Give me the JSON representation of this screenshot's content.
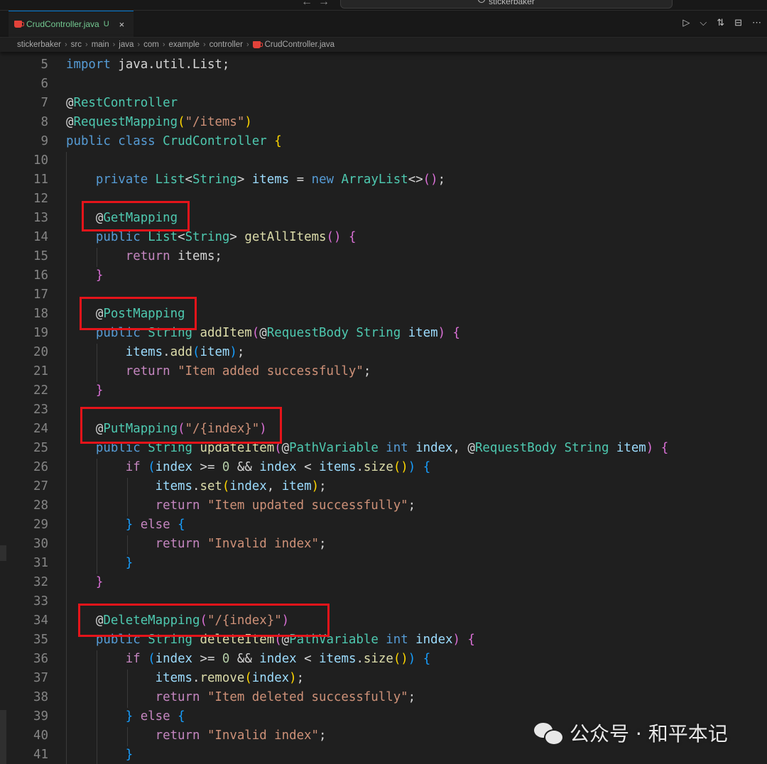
{
  "window": {
    "search_text": "stickerbaker"
  },
  "tab": {
    "file_name": "CrudController.java",
    "status": "U",
    "close_glyph": "×"
  },
  "tab_actions": {
    "run_glyph": "▷",
    "chevron_glyph": "⌵",
    "compare_glyph": "⇅",
    "split_glyph": "⊟",
    "more_glyph": "⋯"
  },
  "breadcrumb": [
    "stickerbaker",
    "src",
    "main",
    "java",
    "com",
    "example",
    "controller",
    "CrudController.java"
  ],
  "code_lines": [
    {
      "n": "5",
      "tokens": [
        [
          "kw",
          "import"
        ],
        [
          "pl",
          " java.util.List;"
        ]
      ]
    },
    {
      "n": "6",
      "tokens": []
    },
    {
      "n": "7",
      "tokens": [
        [
          "pl",
          "@"
        ],
        [
          "ty",
          "RestController"
        ]
      ]
    },
    {
      "n": "8",
      "tokens": [
        [
          "pl",
          "@"
        ],
        [
          "ty",
          "RequestMapping"
        ],
        [
          "br1",
          "("
        ],
        [
          "str",
          "\"/items\""
        ],
        [
          "br1",
          ")"
        ]
      ]
    },
    {
      "n": "9",
      "tokens": [
        [
          "kw",
          "public class "
        ],
        [
          "ty",
          "CrudController "
        ],
        [
          "br1",
          "{"
        ]
      ]
    },
    {
      "n": "10",
      "tokens": []
    },
    {
      "n": "11",
      "tokens": [
        [
          "pl",
          "    "
        ],
        [
          "kw",
          "private "
        ],
        [
          "ty",
          "List"
        ],
        [
          "pl",
          "<"
        ],
        [
          "ty",
          "String"
        ],
        [
          "pl",
          "> "
        ],
        [
          "var",
          "items"
        ],
        [
          "pl",
          " = "
        ],
        [
          "kw",
          "new "
        ],
        [
          "ty",
          "ArrayList"
        ],
        [
          "pl",
          "<>"
        ],
        [
          "br2",
          "()"
        ],
        [
          "pl",
          ";"
        ]
      ]
    },
    {
      "n": "12",
      "tokens": []
    },
    {
      "n": "13",
      "tokens": [
        [
          "pl",
          "    @"
        ],
        [
          "ty",
          "GetMapping"
        ]
      ]
    },
    {
      "n": "14",
      "tokens": [
        [
          "pl",
          "    "
        ],
        [
          "kw",
          "public "
        ],
        [
          "ty",
          "List"
        ],
        [
          "pl",
          "<"
        ],
        [
          "ty",
          "String"
        ],
        [
          "pl",
          "> "
        ],
        [
          "fn",
          "getAllItems"
        ],
        [
          "br2",
          "()"
        ],
        [
          "pl",
          " "
        ],
        [
          "br2",
          "{"
        ]
      ]
    },
    {
      "n": "15",
      "tokens": [
        [
          "pl",
          "        "
        ],
        [
          "ctl",
          "return "
        ],
        [
          "pl",
          "items;"
        ]
      ]
    },
    {
      "n": "16",
      "tokens": [
        [
          "pl",
          "    "
        ],
        [
          "br2",
          "}"
        ]
      ]
    },
    {
      "n": "17",
      "tokens": []
    },
    {
      "n": "18",
      "tokens": [
        [
          "pl",
          "    @"
        ],
        [
          "ty",
          "PostMapping"
        ]
      ]
    },
    {
      "n": "19",
      "tokens": [
        [
          "pl",
          "    "
        ],
        [
          "kw",
          "public "
        ],
        [
          "ty",
          "String "
        ],
        [
          "fn",
          "addItem"
        ],
        [
          "br2",
          "("
        ],
        [
          "pl",
          "@"
        ],
        [
          "ty",
          "RequestBody "
        ],
        [
          "ty",
          "String "
        ],
        [
          "var",
          "item"
        ],
        [
          "br2",
          ")"
        ],
        [
          "pl",
          " "
        ],
        [
          "br2",
          "{"
        ]
      ]
    },
    {
      "n": "20",
      "tokens": [
        [
          "pl",
          "        "
        ],
        [
          "var",
          "items"
        ],
        [
          "pl",
          "."
        ],
        [
          "fn",
          "add"
        ],
        [
          "br3",
          "("
        ],
        [
          "var",
          "item"
        ],
        [
          "br3",
          ")"
        ],
        [
          "pl",
          ";"
        ]
      ]
    },
    {
      "n": "21",
      "tokens": [
        [
          "pl",
          "        "
        ],
        [
          "ctl",
          "return "
        ],
        [
          "str",
          "\"Item added successfully\""
        ],
        [
          "pl",
          ";"
        ]
      ]
    },
    {
      "n": "22",
      "tokens": [
        [
          "pl",
          "    "
        ],
        [
          "br2",
          "}"
        ]
      ]
    },
    {
      "n": "23",
      "tokens": []
    },
    {
      "n": "24",
      "tokens": [
        [
          "pl",
          "    @"
        ],
        [
          "ty",
          "PutMapping"
        ],
        [
          "br2",
          "("
        ],
        [
          "str",
          "\"/{index}\""
        ],
        [
          "br2",
          ")"
        ]
      ]
    },
    {
      "n": "25",
      "tokens": [
        [
          "pl",
          "    "
        ],
        [
          "kw",
          "public "
        ],
        [
          "ty",
          "String "
        ],
        [
          "fn",
          "updateItem"
        ],
        [
          "br2",
          "("
        ],
        [
          "pl",
          "@"
        ],
        [
          "ty",
          "PathVariable "
        ],
        [
          "kw",
          "int "
        ],
        [
          "var",
          "index"
        ],
        [
          "pl",
          ", @"
        ],
        [
          "ty",
          "RequestBody "
        ],
        [
          "ty",
          "String "
        ],
        [
          "var",
          "item"
        ],
        [
          "br2",
          ")"
        ],
        [
          "pl",
          " "
        ],
        [
          "br2",
          "{"
        ]
      ]
    },
    {
      "n": "26",
      "tokens": [
        [
          "pl",
          "        "
        ],
        [
          "ctl",
          "if "
        ],
        [
          "br3",
          "("
        ],
        [
          "var",
          "index"
        ],
        [
          "pl",
          " >= "
        ],
        [
          "num",
          "0"
        ],
        [
          "pl",
          " && "
        ],
        [
          "var",
          "index"
        ],
        [
          "pl",
          " < "
        ],
        [
          "var",
          "items"
        ],
        [
          "pl",
          "."
        ],
        [
          "fn",
          "size"
        ],
        [
          "br1",
          "()"
        ],
        [
          "br3",
          ")"
        ],
        [
          "pl",
          " "
        ],
        [
          "br3",
          "{"
        ]
      ]
    },
    {
      "n": "27",
      "tokens": [
        [
          "pl",
          "            "
        ],
        [
          "var",
          "items"
        ],
        [
          "pl",
          "."
        ],
        [
          "fn",
          "set"
        ],
        [
          "br1",
          "("
        ],
        [
          "var",
          "index"
        ],
        [
          "pl",
          ", "
        ],
        [
          "var",
          "item"
        ],
        [
          "br1",
          ")"
        ],
        [
          "pl",
          ";"
        ]
      ]
    },
    {
      "n": "28",
      "tokens": [
        [
          "pl",
          "            "
        ],
        [
          "ctl",
          "return "
        ],
        [
          "str",
          "\"Item updated successfully\""
        ],
        [
          "pl",
          ";"
        ]
      ]
    },
    {
      "n": "29",
      "tokens": [
        [
          "pl",
          "        "
        ],
        [
          "br3",
          "}"
        ],
        [
          "pl",
          " "
        ],
        [
          "ctl",
          "else "
        ],
        [
          "br3",
          "{"
        ]
      ]
    },
    {
      "n": "30",
      "tokens": [
        [
          "pl",
          "            "
        ],
        [
          "ctl",
          "return "
        ],
        [
          "str",
          "\"Invalid index\""
        ],
        [
          "pl",
          ";"
        ]
      ]
    },
    {
      "n": "31",
      "tokens": [
        [
          "pl",
          "        "
        ],
        [
          "br3",
          "}"
        ]
      ]
    },
    {
      "n": "32",
      "tokens": [
        [
          "pl",
          "    "
        ],
        [
          "br2",
          "}"
        ]
      ]
    },
    {
      "n": "33",
      "tokens": []
    },
    {
      "n": "34",
      "tokens": [
        [
          "pl",
          "    @"
        ],
        [
          "ty",
          "DeleteMapping"
        ],
        [
          "br2",
          "("
        ],
        [
          "str",
          "\"/{index}\""
        ],
        [
          "br2",
          ")"
        ]
      ]
    },
    {
      "n": "35",
      "tokens": [
        [
          "pl",
          "    "
        ],
        [
          "kw",
          "public "
        ],
        [
          "ty",
          "String "
        ],
        [
          "fn",
          "deleteItem"
        ],
        [
          "br2",
          "("
        ],
        [
          "pl",
          "@"
        ],
        [
          "ty",
          "PathVariable "
        ],
        [
          "kw",
          "int "
        ],
        [
          "var",
          "index"
        ],
        [
          "br2",
          ")"
        ],
        [
          "pl",
          " "
        ],
        [
          "br2",
          "{"
        ]
      ]
    },
    {
      "n": "36",
      "tokens": [
        [
          "pl",
          "        "
        ],
        [
          "ctl",
          "if "
        ],
        [
          "br3",
          "("
        ],
        [
          "var",
          "index"
        ],
        [
          "pl",
          " >= "
        ],
        [
          "num",
          "0"
        ],
        [
          "pl",
          " && "
        ],
        [
          "var",
          "index"
        ],
        [
          "pl",
          " < "
        ],
        [
          "var",
          "items"
        ],
        [
          "pl",
          "."
        ],
        [
          "fn",
          "size"
        ],
        [
          "br1",
          "()"
        ],
        [
          "br3",
          ")"
        ],
        [
          "pl",
          " "
        ],
        [
          "br3",
          "{"
        ]
      ]
    },
    {
      "n": "37",
      "tokens": [
        [
          "pl",
          "            "
        ],
        [
          "var",
          "items"
        ],
        [
          "pl",
          "."
        ],
        [
          "fn",
          "remove"
        ],
        [
          "br1",
          "("
        ],
        [
          "var",
          "index"
        ],
        [
          "br1",
          ")"
        ],
        [
          "pl",
          ";"
        ]
      ]
    },
    {
      "n": "38",
      "tokens": [
        [
          "pl",
          "            "
        ],
        [
          "ctl",
          "return "
        ],
        [
          "str",
          "\"Item deleted successfully\""
        ],
        [
          "pl",
          ";"
        ]
      ]
    },
    {
      "n": "39",
      "tokens": [
        [
          "pl",
          "        "
        ],
        [
          "br3",
          "}"
        ],
        [
          "pl",
          " "
        ],
        [
          "ctl",
          "else "
        ],
        [
          "br3",
          "{"
        ]
      ]
    },
    {
      "n": "40",
      "tokens": [
        [
          "pl",
          "            "
        ],
        [
          "ctl",
          "return "
        ],
        [
          "str",
          "\"Invalid index\""
        ],
        [
          "pl",
          ";"
        ]
      ]
    },
    {
      "n": "41",
      "tokens": [
        [
          "pl",
          "        "
        ],
        [
          "br3",
          "}"
        ]
      ]
    }
  ],
  "highlight_color": "#e5141a",
  "watermark": "公众号 · 和平本记"
}
